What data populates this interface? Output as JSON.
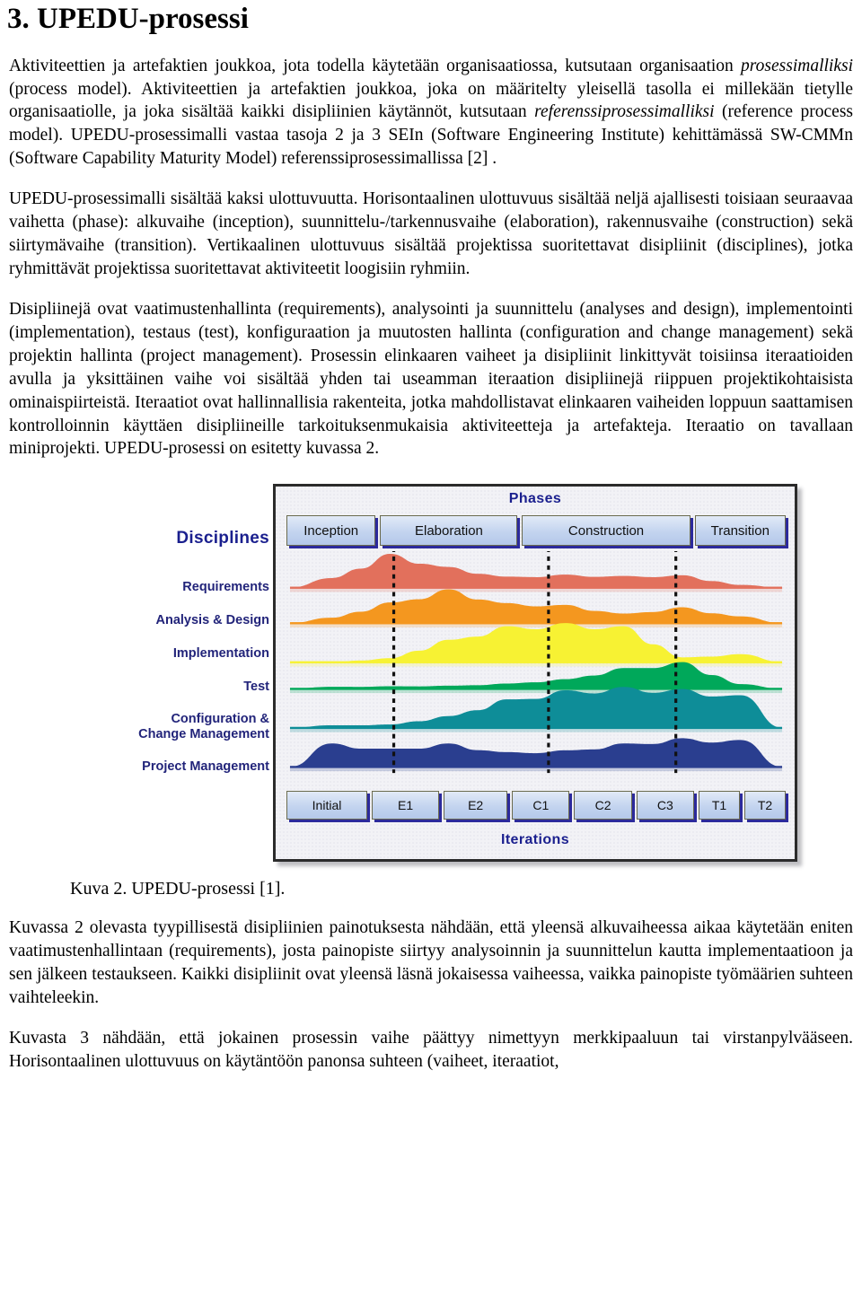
{
  "document": {
    "heading": "3. UPEDU-prosessi",
    "paragraphs": {
      "p1_a": "Aktiviteettien ja artefaktien joukkoa, jota todella käytetään organisaatiossa, kutsutaan organisaation ",
      "p1_italic1": "prosessimalliksi",
      "p1_b": " (process model). Aktiviteettien ja artefaktien joukkoa, joka on määritelty yleisellä tasolla ei millekään tietylle organisaatiolle, ja joka sisältää kaikki disipliinien käytännöt, kutsutaan ",
      "p1_italic2": "referenssiprosessimalliksi",
      "p1_c": " (reference process model). UPEDU-prosessimalli vastaa tasoja 2 ja 3 SEIn (Software Engineering Institute) kehittämässä SW-CMMn (Software Capability Maturity Model) referenssiprosessimallissa [2] .",
      "p2": "UPEDU-prosessimalli sisältää kaksi ulottuvuutta. Horisontaalinen ulottuvuus sisältää neljä ajallisesti toisiaan seuraavaa vaihetta (phase): alkuvaihe (inception), suunnittelu-/tarkennusvaihe (elaboration), rakennusvaihe (construction) sekä siirtymävaihe (transition). Vertikaalinen ulottuvuus sisältää projektissa suoritettavat disipliinit (disciplines), jotka ryhmittävät projektissa suoritettavat aktiviteetit loogisiin ryhmiin.",
      "p3": "Disipliinejä ovat vaatimustenhallinta (requirements), analysointi ja suunnittelu (analyses and design), implementointi (implementation), testaus (test), konfiguraation ja muutosten hallinta (configuration and change management) sekä projektin hallinta (project management). Prosessin elinkaaren vaiheet ja disipliinit linkittyvät toisiinsa iteraatioiden avulla ja yksittäinen vaihe voi sisältää yhden tai useamman iteraation disipliinejä riippuen projektikohtaisista ominaispiirteistä. Iteraatiot ovat hallinnallisia rakenteita, jotka mahdollistavat elinkaaren vaiheiden loppuun saattamisen kontrolloinnin käyttäen disipliineille tarkoituksenmukaisia aktiviteetteja ja artefakteja. Iteraatio on tavallaan miniprojekti. UPEDU-prosessi on esitetty kuvassa 2.",
      "p4": "Kuvassa 2 olevasta tyypillisestä disipliinien painotuksesta nähdään, että yleensä alkuvaiheessa aikaa käytetään  eniten vaatimustenhallintaan (requirements), josta painopiste siirtyy analysoinnin ja suunnittelun kautta implementaatioon ja sen jälkeen testaukseen. Kaikki disipliinit ovat yleensä läsnä jokaisessa vaiheessa, vaikka painopiste työmäärien suhteen vaihteleekin.",
      "p5": "Kuvasta 3 nähdään, että jokainen prosessin vaihe päättyy nimettyyn merkkipaaluun tai virstanpylvääseen. Horisontaalinen ulottuvuus on käytäntöön panonsa suhteen (vaiheet, iteraatiot,"
    },
    "figure_caption": "Kuva 2. UPEDU-prosessi [1]."
  },
  "figure": {
    "disciplines_title": "Disciplines",
    "phases_title": "Phases",
    "iterations_title": "Iterations",
    "disciplines": [
      "Requirements",
      "Analysis & Design",
      "Implementation",
      "Test",
      "Configuration &\nChange Management",
      "Project Management"
    ],
    "discipline_labels": {
      "requirements": "Requirements",
      "analysis_design": "Analysis & Design",
      "implementation": "Implementation",
      "test": "Test",
      "config_line1": "Configuration &",
      "config_line2": "Change Management",
      "project_management": "Project Management"
    },
    "phases": [
      {
        "label": "Inception",
        "flex": 1.0
      },
      {
        "label": "Elaboration",
        "flex": 1.55
      },
      {
        "label": "Construction",
        "flex": 1.9
      },
      {
        "label": "Transition",
        "flex": 1.02
      }
    ],
    "iterations": [
      {
        "label": "Initial",
        "flex": 1.3
      },
      {
        "label": "E1",
        "flex": 1.08
      },
      {
        "label": "E2",
        "flex": 1.02
      },
      {
        "label": "C1",
        "flex": 0.92
      },
      {
        "label": "C2",
        "flex": 0.92
      },
      {
        "label": "C3",
        "flex": 0.92
      },
      {
        "label": "T1",
        "flex": 0.65
      },
      {
        "label": "T2",
        "flex": 0.65
      }
    ],
    "colors": {
      "requirements": "#e2705c",
      "analysis_design": "#f4971f",
      "implementation": "#f7f233",
      "test": "#00a85a",
      "config_change": "#0e8d98",
      "project_management": "#2a3e8f",
      "box_fill": "#c3d4ef",
      "box_shadow": "#2c2a9c",
      "label_navy": "#1a1f8e",
      "chart_bg": "#f2f2f6",
      "chart_border": "#2b2b2b"
    }
  },
  "chart_data": {
    "type": "area",
    "title": "UPEDU process — discipline effort over phases",
    "xlabel": "Iterations",
    "ylabel": "Disciplines",
    "x": [
      "Initial",
      "E1",
      "E2",
      "C1",
      "C2",
      "C3",
      "T1",
      "T2"
    ],
    "phase_boundaries": [
      "Inception|Elaboration",
      "Elaboration|Construction",
      "Construction|Transition"
    ],
    "grid": false,
    "legend": "none",
    "series": [
      {
        "name": "Requirements",
        "color": "#e2705c",
        "values": [
          0.3,
          1.0,
          0.62,
          0.34,
          0.4,
          0.36,
          0.38,
          0.1
        ]
      },
      {
        "name": "Analysis & Design",
        "color": "#f4971f",
        "values": [
          0.18,
          0.62,
          1.0,
          0.6,
          0.55,
          0.3,
          0.48,
          0.22
        ]
      },
      {
        "name": "Implementation",
        "color": "#f7f233",
        "values": [
          0.02,
          0.12,
          0.58,
          0.92,
          1.0,
          0.92,
          0.14,
          0.22
        ]
      },
      {
        "name": "Test",
        "color": "#00a85a",
        "values": [
          0.1,
          0.12,
          0.14,
          0.22,
          0.38,
          0.78,
          1.0,
          0.2
        ]
      },
      {
        "name": "Configuration & Change Management",
        "color": "#0e8d98",
        "values": [
          0.08,
          0.1,
          0.3,
          0.7,
          0.92,
          1.0,
          0.95,
          0.8
        ]
      },
      {
        "name": "Project Management",
        "color": "#2a3e8f",
        "values": [
          0.7,
          0.55,
          0.7,
          0.45,
          0.5,
          0.7,
          0.85,
          0.8
        ]
      }
    ]
  }
}
